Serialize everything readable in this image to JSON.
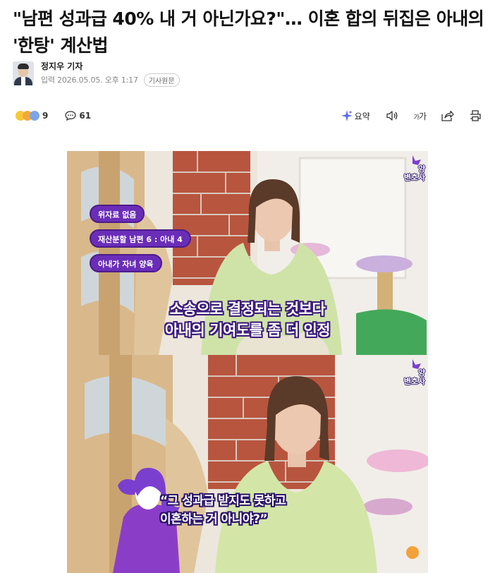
{
  "article": {
    "headline": "\"남편 성과급 40% 내 거 아닌가요?\"… 이혼 합의 뒤집은 아내의 '한탕' 계산법",
    "reporter": "정지우 기자",
    "date_line": "입력 2026.05.05. 오후 1:17",
    "original_label": "기사원문"
  },
  "toolbar": {
    "reaction_count": "9",
    "comment_count": "61",
    "summary_label": "요약",
    "font_label_small": "가",
    "font_label_large": "가",
    "icons": [
      "reaction-emoji-icon",
      "comment-icon",
      "summary-sparkle-icon",
      "speaker-icon",
      "font-size-icon",
      "share-icon",
      "print-icon"
    ]
  },
  "media": {
    "frame1": {
      "pills": [
        "위자료 없음",
        "재산분할 남편 6 : 아내 4",
        "아내가 자녀 양육"
      ],
      "caption_line1": "소송으로 결정되는 것보다",
      "caption_line2": "아내의 기여도를 좀 더 인정",
      "logo_text_top": "양",
      "logo_text_bottom": "변호사"
    },
    "frame2": {
      "speech_line1": "“그 성과급 받지도 못하고",
      "speech_line2": "이혼하는 거 아니야?”",
      "logo_text_top": "양",
      "logo_text_bottom": "변호사"
    }
  },
  "colors": {
    "accent_purple": "#6a2db8",
    "caption_outline": "#3b1a7a",
    "summary_icon": "#5b6cf0"
  }
}
